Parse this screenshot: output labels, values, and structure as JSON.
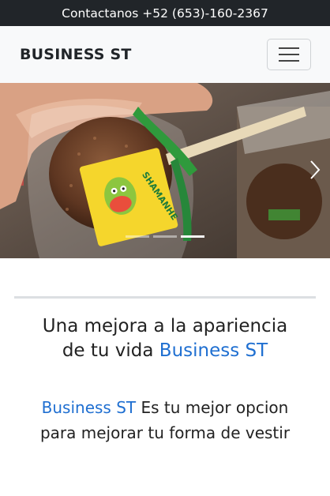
{
  "topbar": {
    "contact_text": "Contactanos +52 (653)-160-2367"
  },
  "navbar": {
    "brand": "BUSINESS ST",
    "toggle_icon": "hamburger-icon"
  },
  "carousel": {
    "slide_count": 3,
    "active_slide": 3,
    "next_icon": "chevron-right-icon",
    "sticker_text": "SHAMANHE"
  },
  "intro": {
    "headline_line1": "Una mejora a la apariencia",
    "headline_line2_prefix": "de tu vida ",
    "headline_accent": "Business ST",
    "desc_accent": "Business ST",
    "desc_text": " Es tu mejor opcion para mejorar tu forma de vestir"
  },
  "colors": {
    "accent": "#1f6fd1",
    "topbar_bg": "#212529",
    "navbar_bg": "#f8f9fa"
  }
}
